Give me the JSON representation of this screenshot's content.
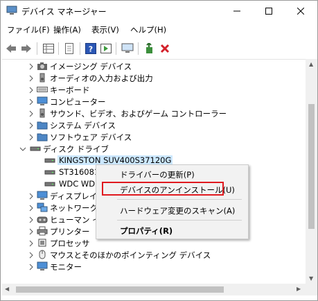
{
  "window": {
    "title": "デバイス マネージャー",
    "controls": {
      "minimize": "minimize-icon",
      "maximize": "maximize-icon",
      "close": "close-icon"
    }
  },
  "menubar": [
    {
      "label": "ファイル(F)"
    },
    {
      "label": "操作(A)"
    },
    {
      "label": "表示(V)"
    },
    {
      "label": "ヘルプ(H)"
    }
  ],
  "toolbar": [
    {
      "icon": "back-arrow-icon"
    },
    {
      "icon": "forward-arrow-icon"
    },
    {
      "icon": "properties-grid-icon"
    },
    {
      "icon": "document-icon"
    },
    {
      "icon": "help-icon"
    },
    {
      "icon": "run-icon"
    },
    {
      "icon": "monitor-icon"
    },
    {
      "icon": "update-driver-icon"
    },
    {
      "icon": "uninstall-x-icon"
    }
  ],
  "tree": {
    "items": [
      {
        "label": "イメージング デバイス",
        "icon": "camera-icon",
        "expanded": false,
        "level": 1
      },
      {
        "label": "オーディオの入力および出力",
        "icon": "speaker-icon",
        "expanded": false,
        "level": 1
      },
      {
        "label": "キーボード",
        "icon": "keyboard-icon",
        "expanded": false,
        "level": 1
      },
      {
        "label": "コンピューター",
        "icon": "computer-icon",
        "expanded": false,
        "level": 1
      },
      {
        "label": "サウンド、ビデオ、およびゲーム コントローラー",
        "icon": "speaker-icon",
        "expanded": false,
        "level": 1
      },
      {
        "label": "システム デバイス",
        "icon": "folder-icon",
        "expanded": false,
        "level": 1
      },
      {
        "label": "ソフトウェア デバイス",
        "icon": "folder-icon",
        "expanded": false,
        "level": 1
      },
      {
        "label": "ディスク ドライブ",
        "icon": "disk-drive-icon",
        "expanded": true,
        "level": 1
      },
      {
        "label": "KINGSTON SUV400S37120G",
        "icon": "disk-drive-icon",
        "level": 2,
        "selected": true
      },
      {
        "label": "ST3160815AS",
        "icon": "disk-drive-icon",
        "level": 2
      },
      {
        "label": "WDC WD5000AAKX",
        "icon": "disk-drive-icon",
        "level": 2
      },
      {
        "label": "ディスプレイ アダプター",
        "icon": "monitor-icon",
        "expanded": false,
        "level": 1
      },
      {
        "label": "ネットワーク アダプター",
        "icon": "network-icon",
        "expanded": false,
        "level": 1
      },
      {
        "label": "ヒューマン インターフェイス デバイス",
        "icon": "hid-icon",
        "expanded": false,
        "level": 1
      },
      {
        "label": "プリンター",
        "icon": "printer-icon",
        "expanded": false,
        "level": 1
      },
      {
        "label": "プロセッサ",
        "icon": "processor-icon",
        "expanded": false,
        "level": 1
      },
      {
        "label": "マウスとそのほかのポインティング デバイス",
        "icon": "mouse-icon",
        "expanded": false,
        "level": 1
      },
      {
        "label": "モニター",
        "icon": "monitor-icon",
        "expanded": false,
        "level": 1
      }
    ]
  },
  "context_menu": {
    "items": [
      {
        "label": "ドライバーの更新(P)"
      },
      {
        "label": "デバイスのアンインストール(U)",
        "highlighted": true
      },
      {
        "label": "ハードウェア変更のスキャン(A)"
      },
      {
        "label": "プロパティ(R)",
        "bold": true
      }
    ],
    "highlight_color": "#e0191f"
  },
  "colors": {
    "selection": "#cce8ff",
    "accent": "#e0191f"
  }
}
